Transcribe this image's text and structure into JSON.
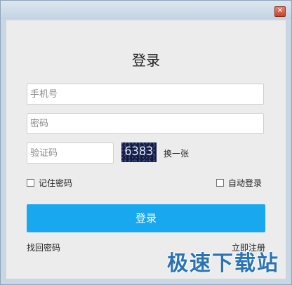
{
  "window": {
    "close_glyph": "✕"
  },
  "login": {
    "title": "登录",
    "phone_placeholder": "手机号",
    "password_placeholder": "密码",
    "captcha_placeholder": "验证码",
    "captcha_text": "6383",
    "refresh_label": "换一张",
    "remember_label": "记住密码",
    "auto_login_label": "自动登录",
    "submit_label": "登录",
    "forgot_label": "找回密码",
    "register_label": "立即注册"
  },
  "watermark": "极速下载站",
  "colors": {
    "accent": "#17a8f0",
    "panel": "#ececec",
    "frame": "#c9d6e4"
  }
}
